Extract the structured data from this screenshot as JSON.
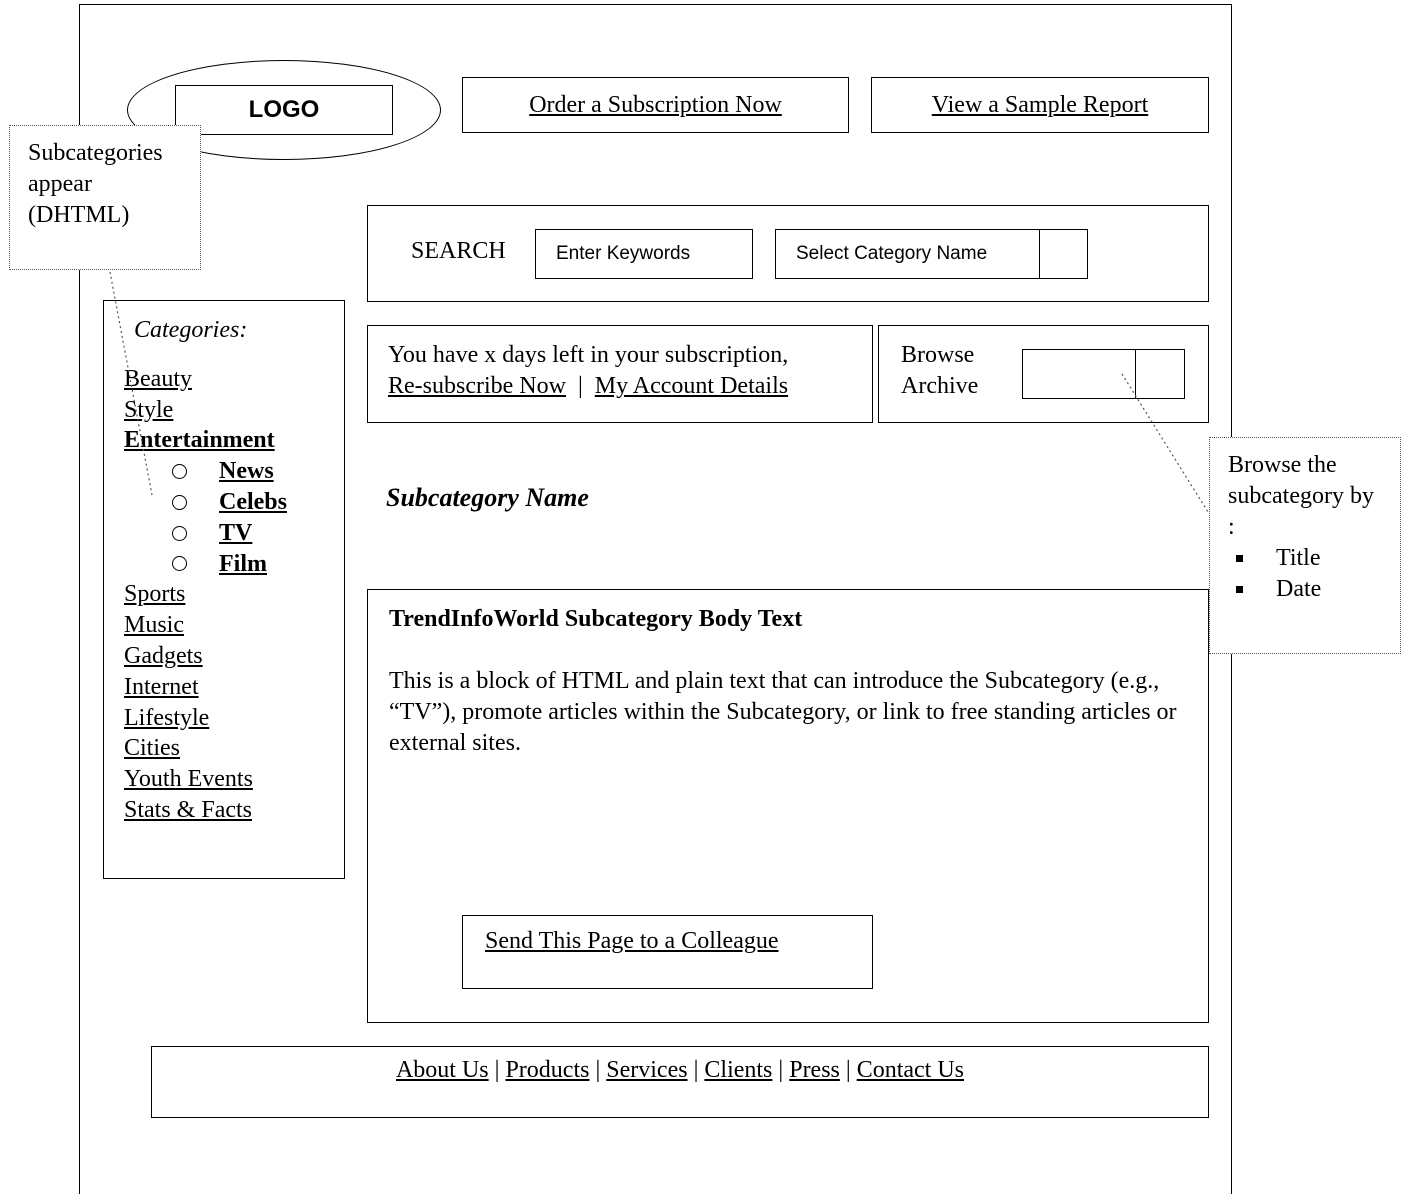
{
  "logo": {
    "label": "LOGO"
  },
  "top_buttons": {
    "order_label": "Order a Subscription Now",
    "sample_label": "View a Sample Report"
  },
  "search": {
    "label": "SEARCH",
    "input_value": "Enter Keywords",
    "category_select_value": "Select Category Name"
  },
  "subscription": {
    "message": "You have x days left in your subscription,",
    "resubscribe_link": "Re-subscribe Now",
    "separator": "|",
    "account_link": "My Account Details"
  },
  "archive": {
    "label_line1": "Browse",
    "label_line2": "Archive"
  },
  "categories": {
    "heading": "Categories:",
    "items": [
      {
        "label": "Beauty"
      },
      {
        "label": "Style"
      },
      {
        "label": "Entertainment"
      },
      {
        "label": "Sports"
      },
      {
        "label": "Music"
      },
      {
        "label": "Gadgets"
      },
      {
        "label": "Internet"
      },
      {
        "label": "Lifestyle"
      },
      {
        "label": "Cities"
      },
      {
        "label": "Youth Events"
      },
      {
        "label": "Stats & Facts"
      }
    ],
    "subitems": [
      {
        "label": "News"
      },
      {
        "label": "Celebs"
      },
      {
        "label": "TV"
      },
      {
        "label": "Film"
      }
    ]
  },
  "subcategory": {
    "name": "Subcategory Name"
  },
  "body": {
    "title": "TrendInfoWorld Subcategory Body Text",
    "text": "This is a block of HTML and plain text that can introduce the Subcategory (e.g., “TV”), promote articles within the Subcategory, or link to free standing articles or external sites.",
    "send_label": "Send This Page to a Colleague"
  },
  "footer": {
    "links": [
      "About Us",
      "Products",
      "Services",
      "Clients",
      "Press",
      "Contact Us"
    ],
    "separator": "|"
  },
  "notes": {
    "left": "Subcategories appear (DHTML)",
    "right_heading": "Browse the subcategory by :",
    "right_items": [
      "Title",
      "Date"
    ]
  }
}
